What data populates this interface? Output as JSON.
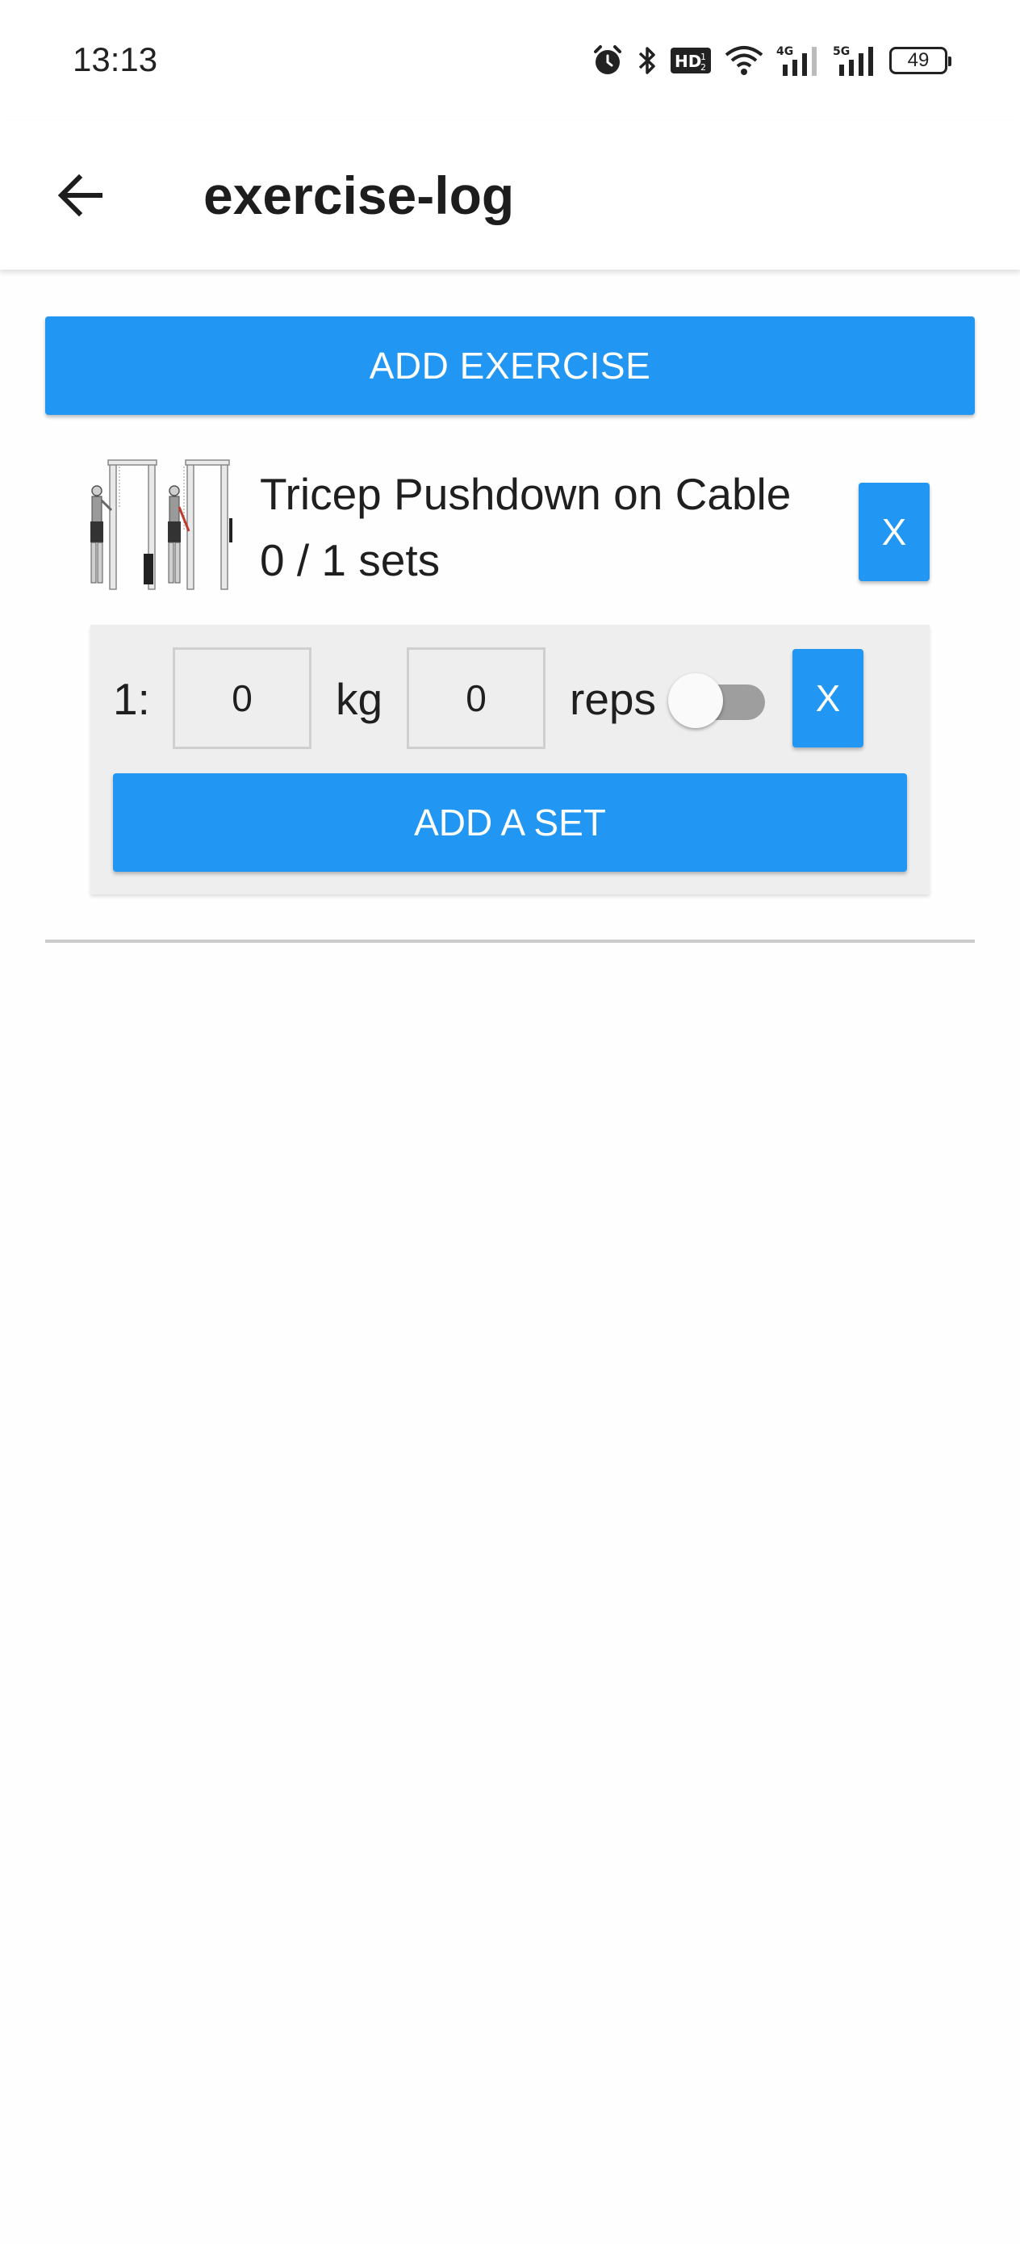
{
  "status_bar": {
    "time": "13:13",
    "battery_level": "49",
    "icons": [
      "alarm-icon",
      "bluetooth-icon",
      "hd-voice-icon",
      "wifi-icon",
      "signal-4g-icon",
      "signal-5g-icon",
      "battery-icon"
    ]
  },
  "app_bar": {
    "title": "exercise-log",
    "back_icon": "arrow-left-icon"
  },
  "main": {
    "add_exercise_label": "ADD EXERCISE",
    "exercise": {
      "name": "Tricep Pushdown on Cable",
      "progress": "0 / 1 sets",
      "remove_label": "X",
      "sets": [
        {
          "number_label": "1:",
          "weight": "0",
          "weight_unit": "kg",
          "reps": "0",
          "reps_unit": "reps",
          "completed": false,
          "remove_label": "X"
        }
      ],
      "add_set_label": "ADD A SET"
    }
  },
  "colors": {
    "primary": "#2196f3",
    "panel_bg": "#eeeeee",
    "toggle_off_track": "#9e9e9e"
  }
}
